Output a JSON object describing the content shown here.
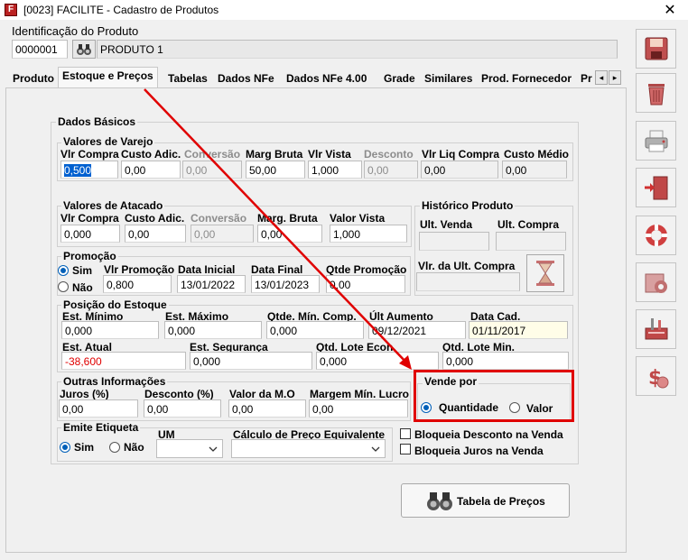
{
  "window": {
    "title": "[0023] FACILITE - Cadastro de Produtos",
    "app_icon": "F",
    "close": "✕"
  },
  "ident": {
    "label": "Identificação do Produto",
    "code": "0000001",
    "name": "PRODUTO 1"
  },
  "tabs": [
    "Produto",
    "Estoque e Preços",
    "Tabelas",
    "Dados NFe",
    "Dados NFe 4.00",
    "Grade",
    "Similares",
    "Prod. Fornecedor",
    "Pr"
  ],
  "tab_scroll": {
    "left": "◂",
    "right": "▸"
  },
  "dados_basicos": "Dados Básicos",
  "varejo": {
    "title": "Valores de Varejo",
    "labels": [
      "Vlr Compra",
      "Custo Adic.",
      "Conversão",
      "Marg Bruta",
      "Vlr Vista",
      "Desconto",
      "Vlr Liq Compra",
      "Custo Médio"
    ],
    "values": [
      "0,500",
      "0,00",
      "0,00",
      "50,00",
      "1,000",
      "0,00",
      "0,00",
      "0,00"
    ]
  },
  "atacado": {
    "title": "Valores de Atacado",
    "labels": [
      "Vlr Compra",
      "Custo Adic.",
      "Conversão",
      "Marg. Bruta",
      "Valor Vista"
    ],
    "values": [
      "0,000",
      "0,00",
      "0,00",
      "0,00",
      "1,000"
    ]
  },
  "historico": {
    "title": "Histórico Produto",
    "ult_venda": "Ult. Venda",
    "ult_compra": "Ult. Compra",
    "vlr_ult_compra": "Vlr. da Ult. Compra"
  },
  "promocao": {
    "title": "Promoção",
    "sim": "Sim",
    "nao": "Não",
    "labels": [
      "Vlr Promoção",
      "Data Inicial",
      "Data Final",
      "Qtde Promoção"
    ],
    "values": [
      "0,800",
      "13/01/2022",
      "13/01/2023",
      "0,00"
    ]
  },
  "posicao": {
    "title": "Posição do Estoque",
    "labels1": [
      "Est. Mínimo",
      "Est. Máximo",
      "Qtde. Mín. Comp.",
      "Últ Aumento",
      "Data Cad."
    ],
    "values1": [
      "0,000",
      "0,000",
      "0,000",
      "09/12/2021",
      "01/11/2017"
    ],
    "labels2": [
      "Est. Atual",
      "Est. Segurança",
      "Qtd. Lote Econ.",
      "Qtd. Lote Min."
    ],
    "values2": [
      "-38,600",
      "0,000",
      "0,000",
      "0,000"
    ]
  },
  "outras": {
    "title": "Outras Informações",
    "labels": [
      "Juros (%)",
      "Desconto (%)",
      "Valor da M.O",
      "Margem Mín. Lucro"
    ],
    "values": [
      "0,00",
      "0,00",
      "0,00",
      "0,00"
    ]
  },
  "vende_por": {
    "title": "Vende por",
    "quantidade": "Quantidade",
    "valor": "Valor"
  },
  "etiqueta": {
    "title": "Emite Etiqueta",
    "sim": "Sim",
    "nao": "Não",
    "um": "UM",
    "calculo": "Cálculo de Preço Equivalente"
  },
  "checks": {
    "bloq_desconto": "Bloqueia Desconto na Venda",
    "bloq_juros": "Bloqueia Juros na Venda"
  },
  "tabela_precos": "Tabela de Preços",
  "colors": {
    "accent": "#005fb8",
    "annotation": "#e00000",
    "negative": "#e00000"
  },
  "side_icons": [
    "save-icon",
    "trash-icon",
    "printer-icon",
    "exit-door-icon",
    "lifebuoy-icon",
    "settings-box-icon",
    "tools-box-icon",
    "money-icon"
  ]
}
